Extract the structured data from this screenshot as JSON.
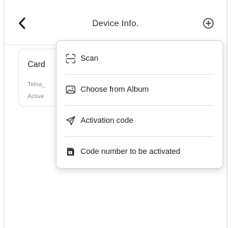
{
  "header": {
    "title": "Device Info."
  },
  "card": {
    "title": "Card",
    "line1": "Telna_",
    "line2": "Active"
  },
  "menu": {
    "items": [
      {
        "label": "Scan",
        "icon": "scan-icon"
      },
      {
        "label": "Choose from Album",
        "icon": "image-icon"
      },
      {
        "label": "Activation code",
        "icon": "send-icon"
      },
      {
        "label": "Code number to be activated",
        "icon": "code-card-icon"
      }
    ]
  },
  "colors": {
    "text": "#1f1f1f",
    "muted": "#8a8a8a",
    "border": "#d6d6d6",
    "icon": "#3a3a3a"
  }
}
